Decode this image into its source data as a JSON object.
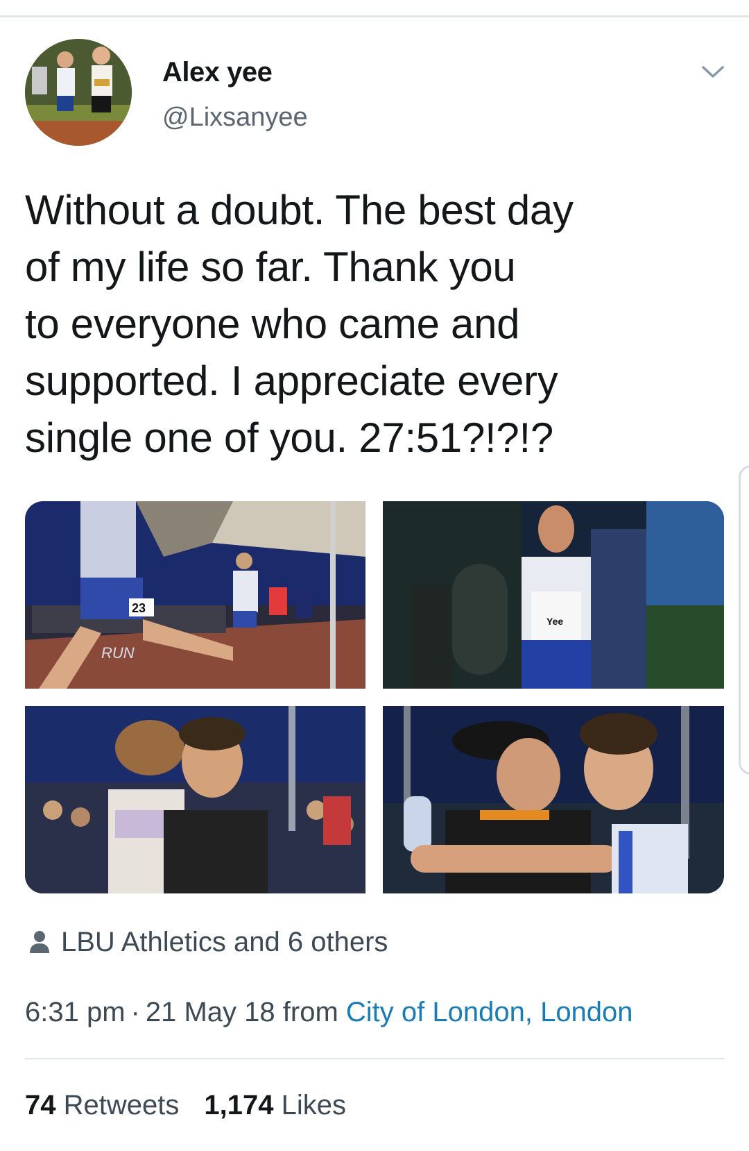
{
  "tweet": {
    "author": {
      "display_name": "Alex yee",
      "handle": "@Lixsanyee"
    },
    "text": "Without a doubt. The best day\nof my life so far. Thank you\nto everyone who came and\nsupported. I appreciate every\nsingle one of you. 27:51?!?!?",
    "likers_text": "LBU Athletics and 6 others",
    "time": "6:31 pm",
    "separator": "·",
    "date": "21 May 18",
    "from_label": "from",
    "location": "City of London, London",
    "retweets_count": "74",
    "retweets_label": "Retweets",
    "likes_count": "1,174",
    "likes_label": "Likes"
  },
  "photos": [
    {
      "label_bib": "23",
      "label_banner": "RUN"
    },
    {
      "label_vest": "Yee"
    },
    {},
    {}
  ],
  "icons": {
    "more_menu": "chevron-down-icon",
    "liker": "person-icon"
  },
  "colors": {
    "text": "#14171a",
    "secondary_text": "#5b6770",
    "link": "#1b7bb5",
    "divider": "#e3e6e8"
  }
}
